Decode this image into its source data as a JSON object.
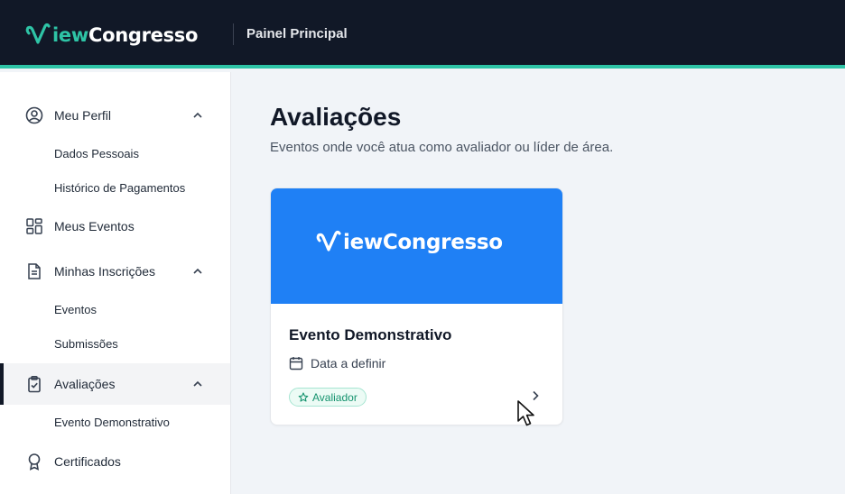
{
  "brand": {
    "logo_v": "V",
    "logo_rest_1": "iew",
    "logo_rest_2": "Congresso",
    "accent": "#2ec4a6",
    "dark": "#111827",
    "blue": "#1f80f5"
  },
  "header": {
    "title": "Painel Principal"
  },
  "sidebar": {
    "items": [
      {
        "label": "Meu Perfil",
        "icon": "user-circle-icon",
        "expanded": true,
        "children": [
          {
            "label": "Dados Pessoais"
          },
          {
            "label": "Histórico de Pagamentos"
          }
        ]
      },
      {
        "label": "Meus Eventos",
        "icon": "grid-icon"
      },
      {
        "label": "Minhas Inscrições",
        "icon": "document-icon",
        "expanded": true,
        "children": [
          {
            "label": "Eventos"
          },
          {
            "label": "Submissões"
          }
        ]
      },
      {
        "label": "Avaliações",
        "icon": "clipboard-check-icon",
        "expanded": true,
        "active": true,
        "children": [
          {
            "label": "Evento Demonstrativo"
          }
        ]
      },
      {
        "label": "Certificados",
        "icon": "award-icon"
      }
    ]
  },
  "main": {
    "title": "Avaliações",
    "subtitle": "Eventos onde você atua como avaliador ou líder de área.",
    "cards": [
      {
        "title": "Evento Demonstrativo",
        "date": "Data a definir",
        "badge": "Avaliador",
        "banner_color": "#1f80f5"
      }
    ]
  }
}
